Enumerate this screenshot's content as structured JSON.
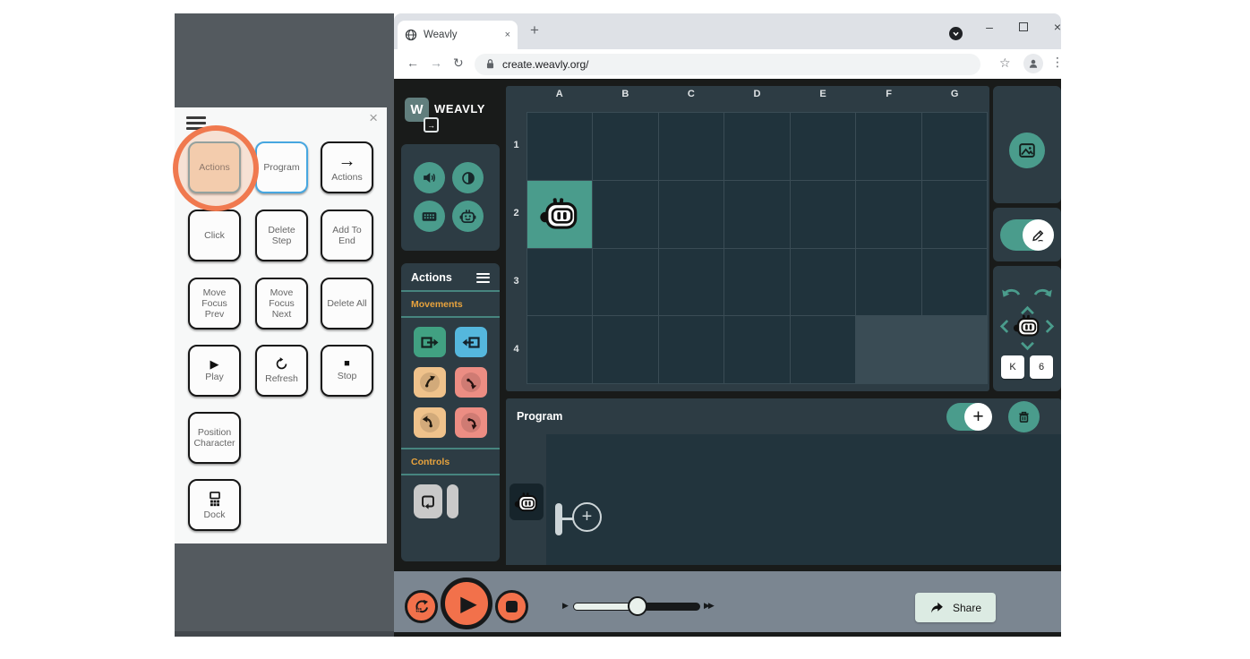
{
  "browser": {
    "tab_title": "Weavly",
    "url": "create.weavly.org/"
  },
  "icons": {
    "close": "×",
    "plus": "+",
    "minimize": "–",
    "back_arrow": "←",
    "forward_arrow": "→",
    "reload": "↻",
    "star": "☆",
    "menu_dots": "⋮",
    "play_triangle": "▶",
    "stop_square": "■",
    "slow_triangle": "▶",
    "fast_triangles": "▶▶",
    "arrow_right": "→",
    "w_letter": "W"
  },
  "overlay": {
    "buttons": {
      "actions": "Actions",
      "program": "Program",
      "to_actions": "Actions",
      "click": "Click",
      "delete_step": "Delete Step",
      "add_to_end": "Add To End",
      "move_focus_prev": "Move Focus Prev",
      "move_focus_next": "Move Focus Next",
      "delete_all": "Delete All",
      "play": "Play",
      "refresh": "Refresh",
      "stop": "Stop",
      "position_character": "Position Character",
      "dock": "Dock"
    }
  },
  "app": {
    "logo_text": "WEAVLY",
    "actions_panel": {
      "title": "Actions",
      "movements_label": "Movements",
      "controls_label": "Controls"
    },
    "world": {
      "columns": [
        "A",
        "B",
        "C",
        "D",
        "E",
        "F",
        "G"
      ],
      "rows": [
        "1",
        "2",
        "3",
        "4"
      ],
      "character_position": "A2"
    },
    "program": {
      "title": "Program"
    },
    "position_controls": {
      "column_value": "K",
      "row_value": "6"
    },
    "share_label": "Share",
    "colors": {
      "teal": "#4a9c8c",
      "section_label_orange": "#e8a33d",
      "coral": "#f2714b",
      "annotation_ring": "#f0794f",
      "forward_green": "#41a182",
      "backward_blue": "#55b7dd",
      "turn_left_tan": "#efc28b",
      "turn_right_salmon": "#ec8d83"
    }
  }
}
